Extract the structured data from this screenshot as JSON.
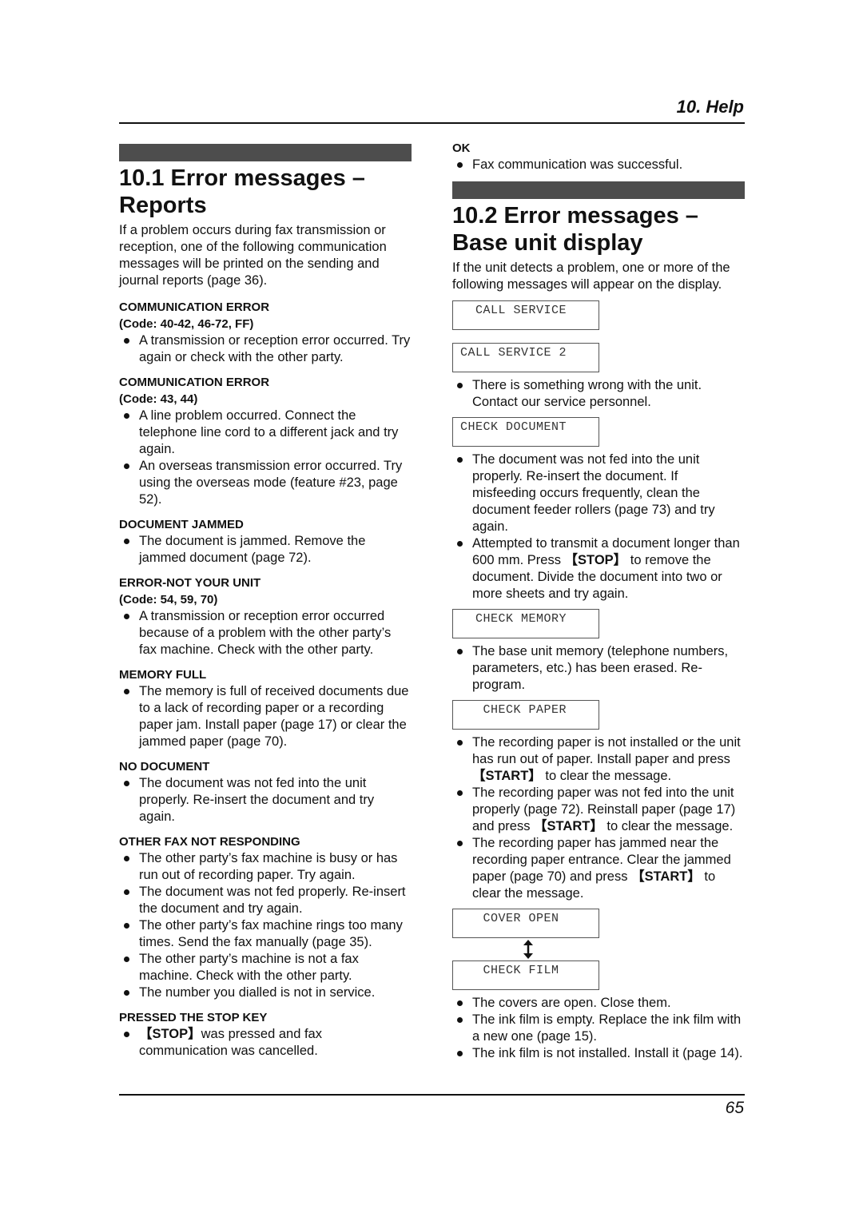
{
  "header": {
    "section": "10. Help"
  },
  "footer": {
    "page_number": "65"
  },
  "left": {
    "title": "10.1 Error messages – Reports",
    "title_line1": "10.1 Error messages –",
    "title_line2": "Reports",
    "intro": "If a problem occurs during fax transmission or reception, one of the following communication messages will be printed on the sending and journal reports (page 36).",
    "entries": [
      {
        "heading": "COMMUNICATION ERROR",
        "code": "(Code: 40-42, 46-72, FF)",
        "bullets": [
          "A transmission or reception error occurred. Try again or check with the other party."
        ]
      },
      {
        "heading": "COMMUNICATION ERROR",
        "code": "(Code: 43, 44)",
        "bullets": [
          "A line problem occurred. Connect the telephone line cord to a different jack and try again.",
          "An overseas transmission error occurred. Try using the overseas mode (feature #23, page 52)."
        ]
      },
      {
        "heading": "DOCUMENT JAMMED",
        "bullets": [
          "The document is jammed. Remove the jammed document (page 72)."
        ]
      },
      {
        "heading": "ERROR-NOT YOUR UNIT",
        "code": "(Code: 54, 59, 70)",
        "bullets": [
          "A transmission or reception error occurred because of a problem with the other party’s fax machine. Check with the other party."
        ]
      },
      {
        "heading": "MEMORY FULL",
        "bullets": [
          "The memory is full of received documents due to a lack of recording paper or a recording paper jam. Install paper (page 17) or clear the jammed paper (page 70)."
        ]
      },
      {
        "heading": "NO DOCUMENT",
        "bullets": [
          "The document was not fed into the unit properly. Re-insert the document and try again."
        ]
      },
      {
        "heading": "OTHER FAX NOT RESPONDING",
        "bullets": [
          "The other party’s fax machine is busy or has run out of recording paper. Try again.",
          "The document was not fed properly. Re-insert the document and try again.",
          "The other party’s fax machine rings too many times. Send the fax manually (page 35).",
          "The other party’s machine is not a fax machine. Check with the other party.",
          "The number you dialled is not in service."
        ]
      },
      {
        "heading": "PRESSED THE STOP KEY",
        "bullets_rich": [
          {
            "key": "【STOP】",
            "text": "was pressed and fax communication was cancelled."
          }
        ]
      }
    ]
  },
  "right": {
    "ok": {
      "heading": "OK",
      "bullets": [
        "Fax communication was successful."
      ]
    },
    "title_line1": "10.2 Error messages –",
    "title_line2": "Base unit display",
    "intro": "If the unit detects a problem, one or more of the following messages will appear on the display.",
    "displays": {
      "call_service": "  CALL SERVICE",
      "call_service_2": "CALL SERVICE 2",
      "check_document": "CHECK DOCUMENT",
      "check_memory": "  CHECK MEMORY",
      "check_paper": "   CHECK PAPER",
      "cover_open": "   COVER OPEN",
      "check_film": "   CHECK FILM"
    },
    "call_service_bullets": [
      "There is something wrong with the unit. Contact our service personnel."
    ],
    "check_document_bullets": [
      "The document was not fed into the unit properly. Re-insert the document. If misfeeding occurs frequently, clean the document feeder rollers (page 73) and try again.",
      {
        "pre": "Attempted to transmit a document longer than 600 mm. Press ",
        "key": "【STOP】",
        "post": " to remove the document. Divide the document into two or more sheets and try again."
      }
    ],
    "check_memory_bullets": [
      "The base unit memory (telephone numbers, parameters, etc.) has been erased. Re-program."
    ],
    "check_paper_bullets": [
      {
        "pre": "The recording paper is not installed or the unit has run out of paper. Install paper and press ",
        "key": "【START】",
        "post": " to clear the message."
      },
      {
        "pre": "The recording paper was not fed into the unit properly (page 72). Reinstall paper (page 17) and press ",
        "key": "【START】",
        "post": " to clear the message."
      },
      {
        "pre": "The recording paper has jammed near the recording paper entrance. Clear the jammed paper (page 70) and press ",
        "key": "【START】",
        "post": " to clear the message."
      }
    ],
    "cover_film_bullets": [
      "The covers are open. Close them.",
      "The ink film is empty. Replace the ink film with a new one (page 15).",
      "The ink film is not installed. Install it (page 14)."
    ],
    "arrow_icon": "up-down-arrow-icon"
  }
}
